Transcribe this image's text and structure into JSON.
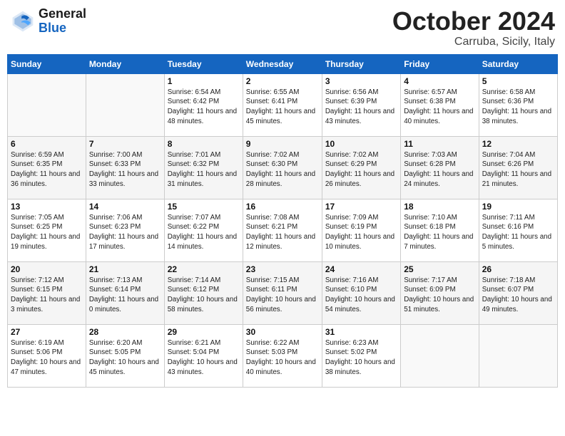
{
  "header": {
    "logo_line1": "General",
    "logo_line2": "Blue",
    "month": "October 2024",
    "location": "Carruba, Sicily, Italy"
  },
  "weekdays": [
    "Sunday",
    "Monday",
    "Tuesday",
    "Wednesday",
    "Thursday",
    "Friday",
    "Saturday"
  ],
  "weeks": [
    [
      {
        "day": "",
        "info": ""
      },
      {
        "day": "",
        "info": ""
      },
      {
        "day": "1",
        "info": "Sunrise: 6:54 AM\nSunset: 6:42 PM\nDaylight: 11 hours and 48 minutes."
      },
      {
        "day": "2",
        "info": "Sunrise: 6:55 AM\nSunset: 6:41 PM\nDaylight: 11 hours and 45 minutes."
      },
      {
        "day": "3",
        "info": "Sunrise: 6:56 AM\nSunset: 6:39 PM\nDaylight: 11 hours and 43 minutes."
      },
      {
        "day": "4",
        "info": "Sunrise: 6:57 AM\nSunset: 6:38 PM\nDaylight: 11 hours and 40 minutes."
      },
      {
        "day": "5",
        "info": "Sunrise: 6:58 AM\nSunset: 6:36 PM\nDaylight: 11 hours and 38 minutes."
      }
    ],
    [
      {
        "day": "6",
        "info": "Sunrise: 6:59 AM\nSunset: 6:35 PM\nDaylight: 11 hours and 36 minutes."
      },
      {
        "day": "7",
        "info": "Sunrise: 7:00 AM\nSunset: 6:33 PM\nDaylight: 11 hours and 33 minutes."
      },
      {
        "day": "8",
        "info": "Sunrise: 7:01 AM\nSunset: 6:32 PM\nDaylight: 11 hours and 31 minutes."
      },
      {
        "day": "9",
        "info": "Sunrise: 7:02 AM\nSunset: 6:30 PM\nDaylight: 11 hours and 28 minutes."
      },
      {
        "day": "10",
        "info": "Sunrise: 7:02 AM\nSunset: 6:29 PM\nDaylight: 11 hours and 26 minutes."
      },
      {
        "day": "11",
        "info": "Sunrise: 7:03 AM\nSunset: 6:28 PM\nDaylight: 11 hours and 24 minutes."
      },
      {
        "day": "12",
        "info": "Sunrise: 7:04 AM\nSunset: 6:26 PM\nDaylight: 11 hours and 21 minutes."
      }
    ],
    [
      {
        "day": "13",
        "info": "Sunrise: 7:05 AM\nSunset: 6:25 PM\nDaylight: 11 hours and 19 minutes."
      },
      {
        "day": "14",
        "info": "Sunrise: 7:06 AM\nSunset: 6:23 PM\nDaylight: 11 hours and 17 minutes."
      },
      {
        "day": "15",
        "info": "Sunrise: 7:07 AM\nSunset: 6:22 PM\nDaylight: 11 hours and 14 minutes."
      },
      {
        "day": "16",
        "info": "Sunrise: 7:08 AM\nSunset: 6:21 PM\nDaylight: 11 hours and 12 minutes."
      },
      {
        "day": "17",
        "info": "Sunrise: 7:09 AM\nSunset: 6:19 PM\nDaylight: 11 hours and 10 minutes."
      },
      {
        "day": "18",
        "info": "Sunrise: 7:10 AM\nSunset: 6:18 PM\nDaylight: 11 hours and 7 minutes."
      },
      {
        "day": "19",
        "info": "Sunrise: 7:11 AM\nSunset: 6:16 PM\nDaylight: 11 hours and 5 minutes."
      }
    ],
    [
      {
        "day": "20",
        "info": "Sunrise: 7:12 AM\nSunset: 6:15 PM\nDaylight: 11 hours and 3 minutes."
      },
      {
        "day": "21",
        "info": "Sunrise: 7:13 AM\nSunset: 6:14 PM\nDaylight: 11 hours and 0 minutes."
      },
      {
        "day": "22",
        "info": "Sunrise: 7:14 AM\nSunset: 6:12 PM\nDaylight: 10 hours and 58 minutes."
      },
      {
        "day": "23",
        "info": "Sunrise: 7:15 AM\nSunset: 6:11 PM\nDaylight: 10 hours and 56 minutes."
      },
      {
        "day": "24",
        "info": "Sunrise: 7:16 AM\nSunset: 6:10 PM\nDaylight: 10 hours and 54 minutes."
      },
      {
        "day": "25",
        "info": "Sunrise: 7:17 AM\nSunset: 6:09 PM\nDaylight: 10 hours and 51 minutes."
      },
      {
        "day": "26",
        "info": "Sunrise: 7:18 AM\nSunset: 6:07 PM\nDaylight: 10 hours and 49 minutes."
      }
    ],
    [
      {
        "day": "27",
        "info": "Sunrise: 6:19 AM\nSunset: 5:06 PM\nDaylight: 10 hours and 47 minutes."
      },
      {
        "day": "28",
        "info": "Sunrise: 6:20 AM\nSunset: 5:05 PM\nDaylight: 10 hours and 45 minutes."
      },
      {
        "day": "29",
        "info": "Sunrise: 6:21 AM\nSunset: 5:04 PM\nDaylight: 10 hours and 43 minutes."
      },
      {
        "day": "30",
        "info": "Sunrise: 6:22 AM\nSunset: 5:03 PM\nDaylight: 10 hours and 40 minutes."
      },
      {
        "day": "31",
        "info": "Sunrise: 6:23 AM\nSunset: 5:02 PM\nDaylight: 10 hours and 38 minutes."
      },
      {
        "day": "",
        "info": ""
      },
      {
        "day": "",
        "info": ""
      }
    ]
  ]
}
